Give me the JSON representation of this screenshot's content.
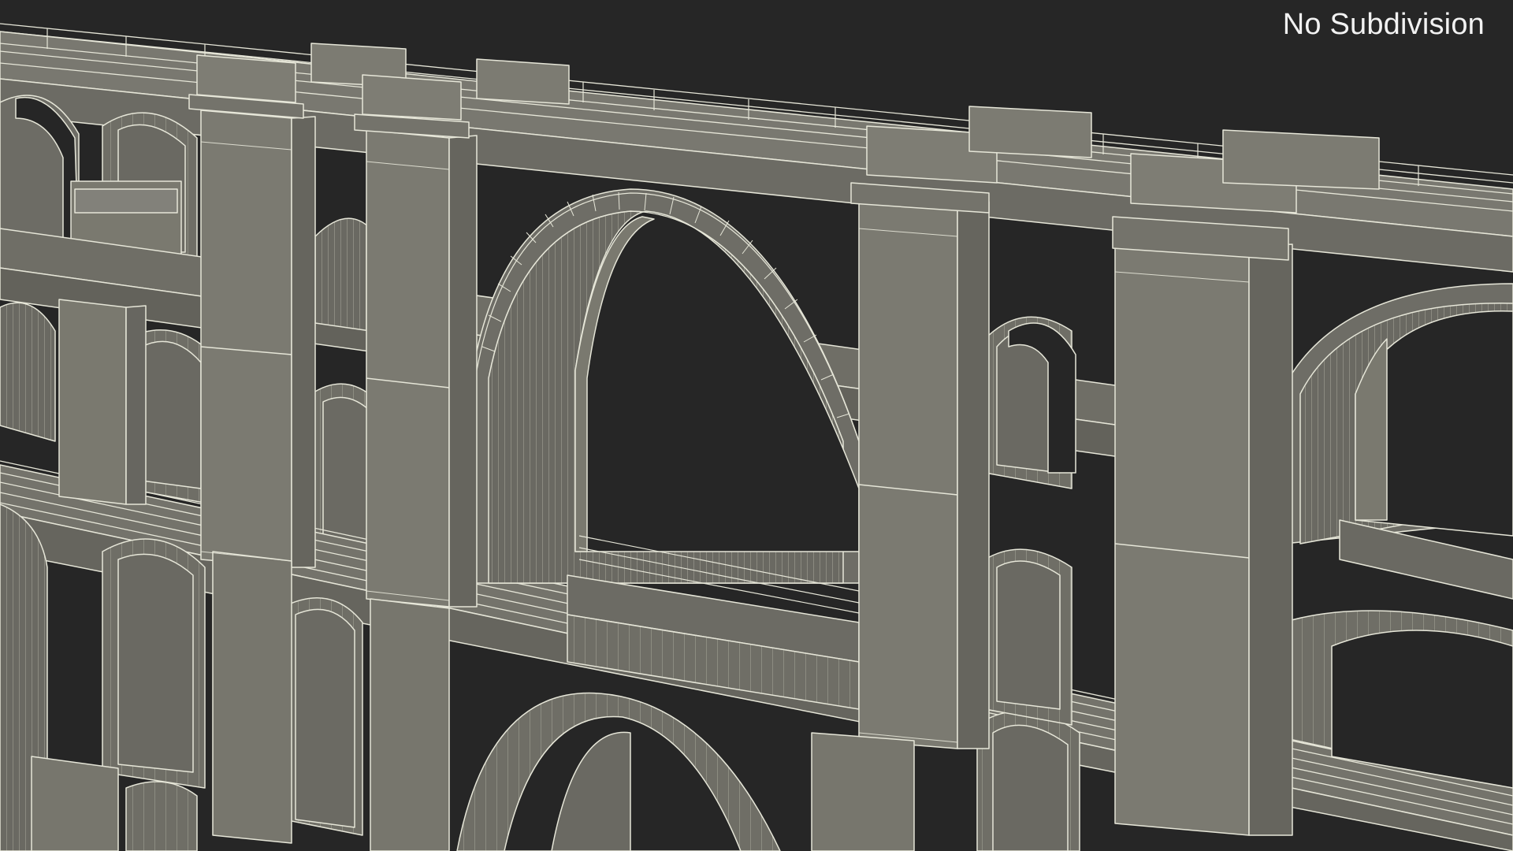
{
  "overlay": {
    "label": "No Subdivision"
  },
  "scene": {
    "subject": "bridge-wireframe-render",
    "colors": {
      "background": "#262626",
      "stone": "#74736b",
      "stone_light": "#84837a",
      "stone_dark": "#5f5e57",
      "wire": "#e6e6d8"
    }
  }
}
